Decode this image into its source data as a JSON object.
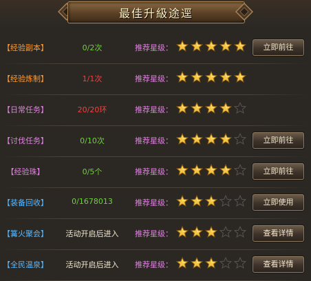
{
  "title": "最佳升級途逕",
  "recommend_label": "推荐星级：",
  "colors": {
    "orange": "#ff9a2e",
    "purple": "#e080e0",
    "blue": "#58b8ff",
    "green": "#6fd23b",
    "red": "#ff3a3a",
    "white": "#f3ead2",
    "star_filled": "#f4c542",
    "star_empty": "#2a2724"
  },
  "rows": [
    {
      "name": "【经验副本】",
      "name_color": "orange",
      "count": "0/2次",
      "count_color": "green",
      "stars": 5,
      "button": "立即前往"
    },
    {
      "name": "【经验炼制】",
      "name_color": "orange",
      "count": "1/1次",
      "count_color": "red",
      "stars": 5,
      "button": ""
    },
    {
      "name": "【日常任务】",
      "name_color": "purple",
      "count": "20/20环",
      "count_color": "red",
      "stars": 4,
      "button": ""
    },
    {
      "name": "【讨伐任务】",
      "name_color": "purple",
      "count": "0/10次",
      "count_color": "green",
      "stars": 4,
      "button": "立即前往"
    },
    {
      "name": "【经验珠】",
      "name_color": "purple",
      "count": "0/5个",
      "count_color": "green",
      "stars": 4,
      "button": "立即前往"
    },
    {
      "name": "【装备回收】",
      "name_color": "blue",
      "count": "0/1678013",
      "count_color": "green",
      "stars": 3,
      "button": "立即使用"
    },
    {
      "name": "【篝火聚会】",
      "name_color": "blue",
      "count": "活动开启后进入",
      "count_color": "white",
      "stars": 3,
      "button": "查看详情"
    },
    {
      "name": "【全民温泉】",
      "name_color": "blue",
      "count": "活动开启后进入",
      "count_color": "white",
      "stars": 3,
      "button": "查看详情"
    }
  ]
}
